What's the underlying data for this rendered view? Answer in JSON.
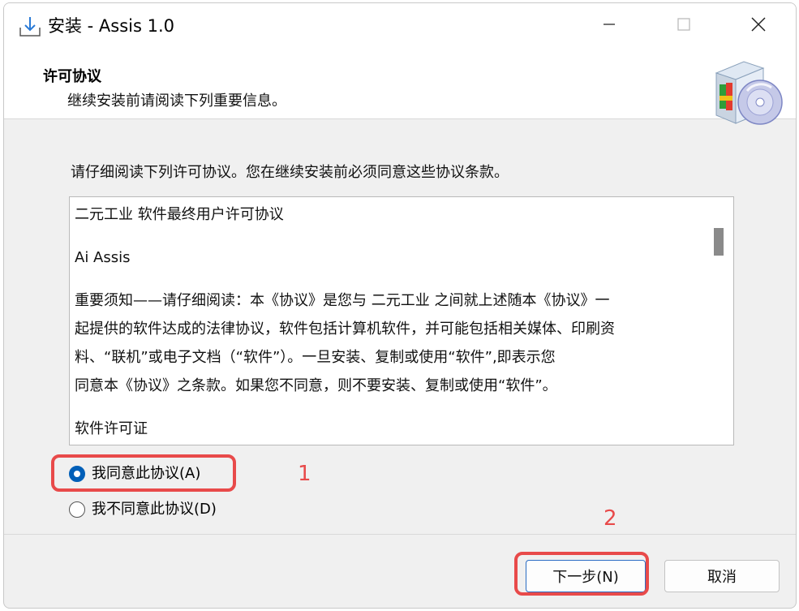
{
  "window": {
    "title": "安装 - Assis 1.0"
  },
  "header": {
    "title": "许可协议",
    "subtitle": "继续安装前请阅读下列重要信息。"
  },
  "instruction": "请仔细阅读下列许可协议。您在继续安装前必须同意这些协议条款。",
  "license": {
    "paragraphs": [
      "二元工业 软件最终用户许可协议",
      "Ai Assis",
      "重要须知——请仔细阅读：本《协议》是您与 二元工业 之间就上述随本《协议》一",
      "起提供的软件达成的法律协议，软件包括计算机软件，并可能包括相关媒体、印刷资",
      "料、“联机”或电子文档（“软件”）。一旦安装、复制或使用“软件”,即表示您",
      "同意本《协议》之条款。如果您不同意，则不要安装、复制或使用“软件”。",
      "软件许可证"
    ]
  },
  "options": {
    "accept_label": "我同意此协议(A)",
    "decline_label": "我不同意此协议(D)",
    "selected": "accept"
  },
  "annotations": {
    "marker_1": "1",
    "marker_2": "2"
  },
  "buttons": {
    "next_label": "下一步(N)",
    "cancel_label": "取消"
  },
  "icons": {
    "app": "installer-icon",
    "minimize": "minimize-icon",
    "maximize": "maximize-icon",
    "close": "close-icon",
    "header": "setup-box-cd-icon"
  },
  "colors": {
    "accent": "#005fb8",
    "annotation": "#e84a4a"
  }
}
